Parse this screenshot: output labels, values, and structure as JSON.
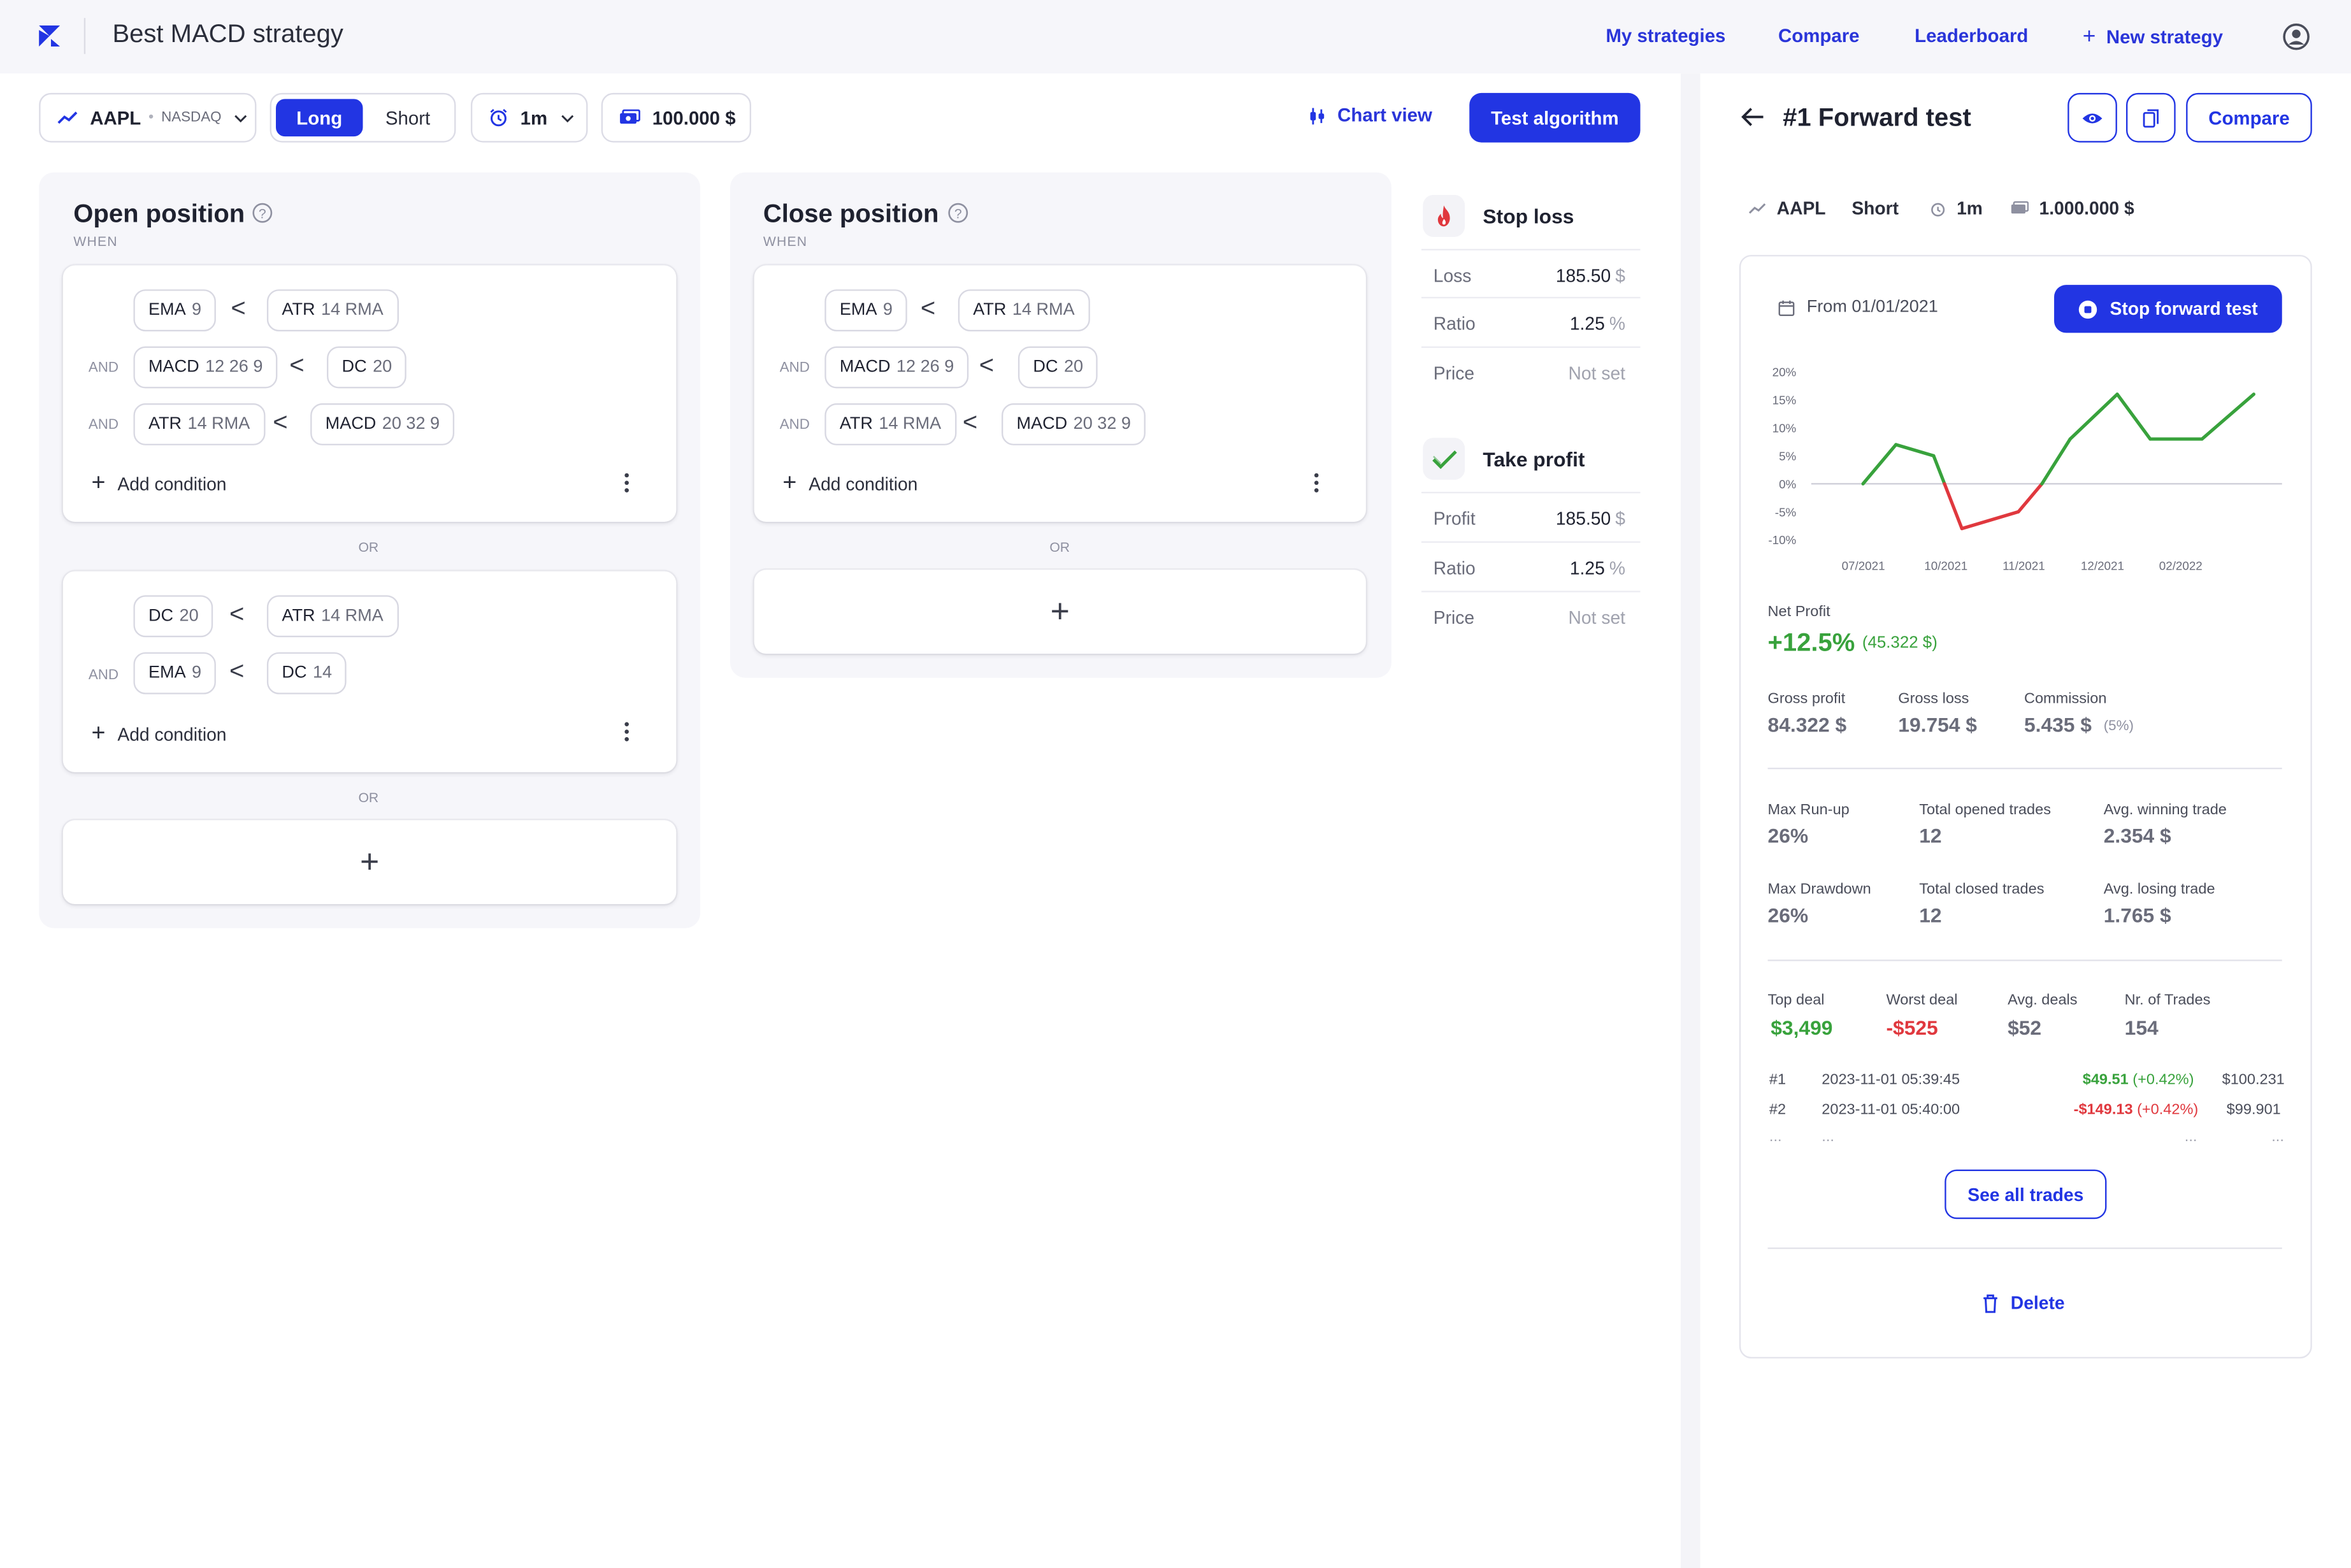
{
  "header": {
    "title": "Best MACD strategy",
    "nav": [
      "My strategies",
      "Compare",
      "Leaderboard",
      "New strategy"
    ]
  },
  "toolbar": {
    "symbol": "AAPL",
    "exchange": "NASDAQ",
    "direction_options": [
      "Long",
      "Short"
    ],
    "direction_selected": "Long",
    "timeframe": "1m",
    "capital": "100.000 $",
    "chart_view": "Chart view",
    "test_button": "Test algorithm"
  },
  "open_position": {
    "title": "Open position",
    "when": "WHEN",
    "groups": [
      {
        "rows": [
          {
            "prefix": "",
            "left": {
              "name": "EMA",
              "params": "9"
            },
            "op": "<",
            "right": {
              "name": "ATR",
              "params": "14 RMA"
            }
          },
          {
            "prefix": "AND",
            "left": {
              "name": "MACD",
              "params": "12 26 9"
            },
            "op": "<",
            "right": {
              "name": "DC",
              "params": "20"
            }
          },
          {
            "prefix": "AND",
            "left": {
              "name": "ATR",
              "params": "14 RMA"
            },
            "op": "<",
            "right": {
              "name": "MACD",
              "params": "20 32 9"
            }
          }
        ],
        "add_label": "Add condition"
      },
      {
        "rows": [
          {
            "prefix": "",
            "left": {
              "name": "DC",
              "params": "20"
            },
            "op": "<",
            "right": {
              "name": "ATR",
              "params": "14 RMA"
            }
          },
          {
            "prefix": "AND",
            "left": {
              "name": "EMA",
              "params": "9"
            },
            "op": "<",
            "right": {
              "name": "DC",
              "params": "14"
            }
          }
        ],
        "add_label": "Add condition"
      }
    ],
    "or_label": "OR"
  },
  "close_position": {
    "title": "Close position",
    "when": "WHEN",
    "groups": [
      {
        "rows": [
          {
            "prefix": "",
            "left": {
              "name": "EMA",
              "params": "9"
            },
            "op": "<",
            "right": {
              "name": "ATR",
              "params": "14 RMA"
            }
          },
          {
            "prefix": "AND",
            "left": {
              "name": "MACD",
              "params": "12 26 9"
            },
            "op": "<",
            "right": {
              "name": "DC",
              "params": "20"
            }
          },
          {
            "prefix": "AND",
            "left": {
              "name": "ATR",
              "params": "14 RMA"
            },
            "op": "<",
            "right": {
              "name": "MACD",
              "params": "20 32 9"
            }
          }
        ],
        "add_label": "Add condition"
      }
    ],
    "or_label": "OR"
  },
  "stop_loss": {
    "title": "Stop loss",
    "rows": [
      {
        "key": "Loss",
        "value": "185.50",
        "unit": "$"
      },
      {
        "key": "Ratio",
        "value": "1.25",
        "unit": "%"
      },
      {
        "key": "Price",
        "value": "Not set",
        "unit": ""
      }
    ]
  },
  "take_profit": {
    "title": "Take profit",
    "rows": [
      {
        "key": "Profit",
        "value": "185.50",
        "unit": "$"
      },
      {
        "key": "Ratio",
        "value": "1.25",
        "unit": "%"
      },
      {
        "key": "Price",
        "value": "Not set",
        "unit": ""
      }
    ]
  },
  "forward_test": {
    "title": "#1 Forward test",
    "compare": "Compare",
    "symbol": "AAPL",
    "direction": "Short",
    "timeframe": "1m",
    "capital": "1.000.000 $",
    "from": "From 01/01/2021",
    "stop_button": "Stop forward test",
    "net_profit_label": "Net Profit",
    "net_profit": "+12.5%",
    "net_profit_abs": "(45.322 $)",
    "gross_profit_label": "Gross profit",
    "gross_profit": "84.322 $",
    "gross_loss_label": "Gross loss",
    "gross_loss": "19.754 $",
    "commission_label": "Commission",
    "commission": "5.435 $",
    "commission_pct": "(5%)",
    "max_runup_label": "Max Run-up",
    "max_runup": "26%",
    "total_opened_label": "Total opened trades",
    "total_opened": "12",
    "avg_win_label": "Avg. winning trade",
    "avg_win": "2.354 $",
    "max_drawdown_label": "Max Drawdown",
    "max_drawdown": "26%",
    "total_closed_label": "Total closed trades",
    "total_closed": "12",
    "avg_loss_label": "Avg. losing trade",
    "avg_loss": "1.765 $",
    "top_deal_label": "Top deal",
    "top_deal": "$3,499",
    "worst_deal_label": "Worst deal",
    "worst_deal": "-$525",
    "avg_deals_label": "Avg. deals",
    "avg_deals": "$52",
    "nr_trades_label": "Nr. of Trades",
    "nr_trades": "154",
    "trades": [
      {
        "id": "#1",
        "time": "2023-11-01 05:39:45",
        "pnl": "$49.51",
        "pct": "(+0.42%)",
        "balance": "$100.231",
        "positive": true
      },
      {
        "id": "#2",
        "time": "2023-11-01 05:40:00",
        "pnl": "-$149.13",
        "pct": "(+0.42%)",
        "balance": "$99.901",
        "positive": false
      }
    ],
    "ellipsis": "...",
    "see_all": "See all trades",
    "delete": "Delete"
  },
  "chart_data": {
    "type": "line",
    "x_tick_labels": [
      "07/2021",
      "10/2021",
      "11/2021",
      "12/2021",
      "02/2022"
    ],
    "y_tick_labels": [
      "20%",
      "15%",
      "10%",
      "5%",
      "0%",
      "-5%",
      "-10%"
    ],
    "ylim": [
      -10,
      20
    ],
    "points": [
      0,
      7,
      5,
      -8,
      -5,
      0,
      8,
      16,
      8,
      8,
      16
    ],
    "colors": {
      "positive": "#38a23c",
      "negative": "#e0383e",
      "zero_line": "#cfcfd8"
    }
  },
  "colors": {
    "accent": "#2235e3",
    "positive": "#38a23c",
    "negative": "#e0383e"
  }
}
